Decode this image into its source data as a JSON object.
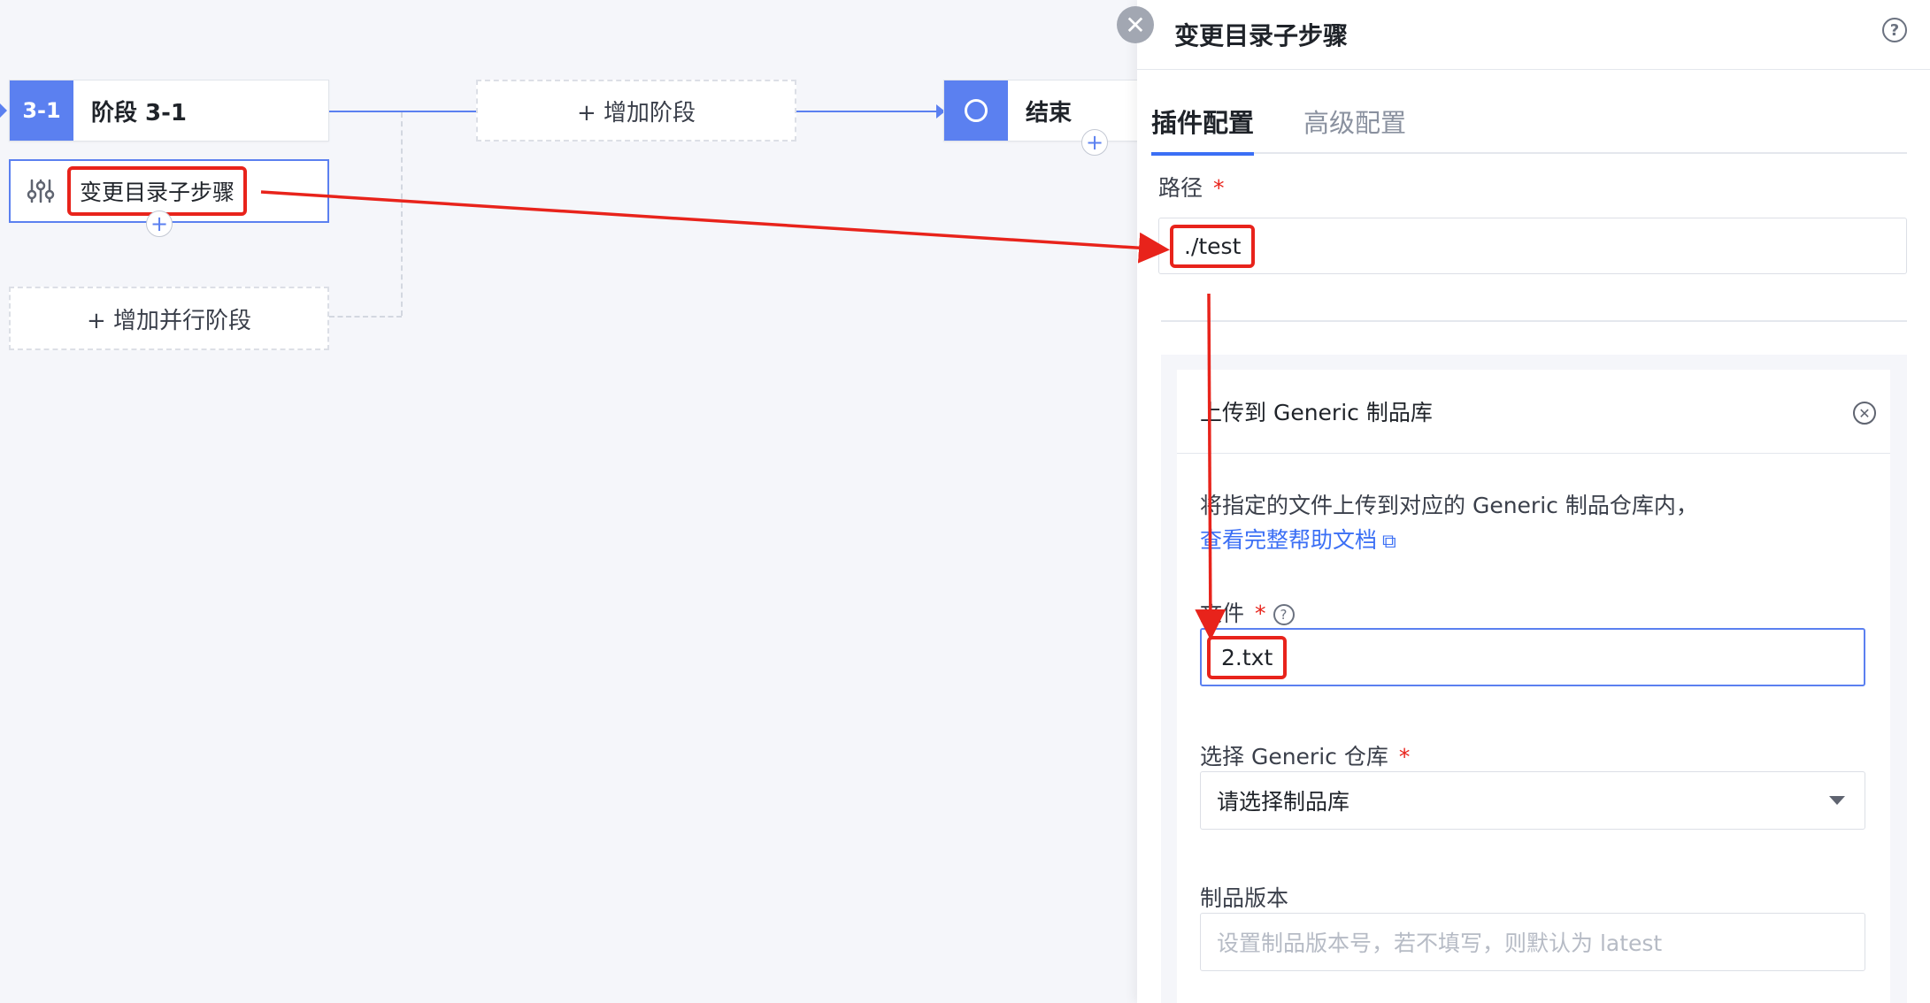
{
  "canvas": {
    "stage": {
      "badge": "3-1",
      "title": "阶段 3-1"
    },
    "step": {
      "label": "变更目录子步骤"
    },
    "add_stage": "+ 增加阶段",
    "add_parallel": "+ 增加并行阶段",
    "end": {
      "title": "结束"
    },
    "plus": "+"
  },
  "drawer": {
    "close": "✕",
    "title": "变更目录子步骤",
    "help": "?",
    "tabs": [
      {
        "label": "插件配置",
        "active": true
      },
      {
        "label": "高级配置",
        "active": false
      }
    ],
    "path": {
      "label": "路径",
      "required": "*",
      "value": "./test"
    },
    "plugin": {
      "name": "上传到 Generic 制品库",
      "remove": "✕",
      "description": "将指定的文件上传到对应的 Generic 制品仓库内，",
      "help_link": "查看完整帮助文档",
      "file": {
        "label": "文件",
        "required": "*",
        "value": "2.txt"
      },
      "repo": {
        "label": "选择 Generic 仓库",
        "required": "*",
        "placeholder": "请选择制品库"
      },
      "version": {
        "label": "制品版本",
        "placeholder": "设置制品版本号，若不填写，则默认为 latest"
      }
    }
  },
  "colors": {
    "accent": "#5b80f0",
    "link": "#3b6ff5",
    "annotation_red": "#e8231b"
  }
}
